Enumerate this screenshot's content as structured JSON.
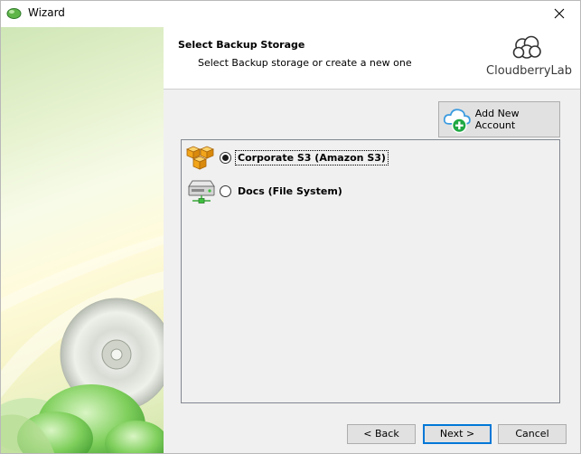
{
  "window": {
    "title": "Wizard"
  },
  "header": {
    "title": "Select Backup Storage",
    "subtitle": "Select Backup storage or create a new one",
    "logo_text": "CloudberryLab"
  },
  "actions": {
    "add_account_label": "Add New Account"
  },
  "storage": {
    "items": [
      {
        "label": "Corporate S3 (Amazon S3)",
        "selected": true,
        "icon": "amazon-s3-boxes-icon"
      },
      {
        "label": "Docs (File System)",
        "selected": false,
        "icon": "hard-drive-icon"
      }
    ]
  },
  "footer": {
    "back_label": "< Back",
    "next_label": "Next >",
    "cancel_label": "Cancel"
  },
  "colors": {
    "accent": "#0078d7",
    "add_icon_green": "#1fa843",
    "cloud_blue": "#3b9be0",
    "s3_orange": "#f2a51a"
  }
}
